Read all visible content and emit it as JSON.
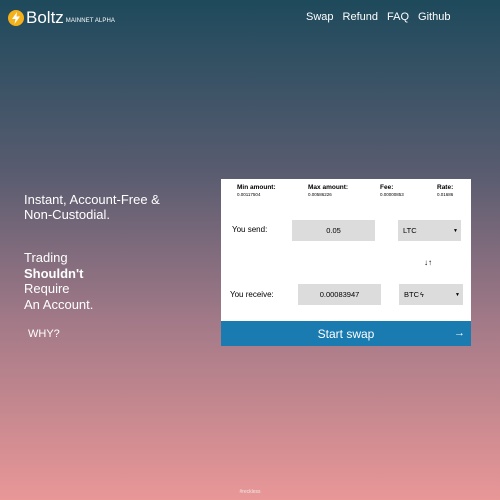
{
  "header": {
    "logo_text": "Boltz",
    "logo_subtitle": "MAINNET ALPHA",
    "nav": [
      "Swap",
      "Refund",
      "FAQ",
      "Github"
    ]
  },
  "hero": {
    "tagline_line1": "Instant, Account-Free &",
    "tagline_line2": "Non-Custodial.",
    "trading": "Trading",
    "shouldnt": "Shouldn't",
    "require": "Require",
    "account": "An Account.",
    "why": "WHY?"
  },
  "swap": {
    "stats": [
      {
        "label": "Min amount:",
        "value": "0.00117504"
      },
      {
        "label": "Max amount:",
        "value": "0.00586226"
      },
      {
        "label": "Fee:",
        "value": "0.00000853"
      },
      {
        "label": "Rate:",
        "value": "0.01686"
      }
    ],
    "send_label": "You send:",
    "send_amount": "0.05",
    "send_coin": "LTC",
    "receive_label": "You receive:",
    "receive_amount": "0.00083947",
    "receive_coin": "BTC",
    "start_label": "Start swap"
  },
  "footer": {
    "text": "#reckless"
  },
  "colors": {
    "accent": "#1a7bb0",
    "logo": "#f5b11a"
  }
}
